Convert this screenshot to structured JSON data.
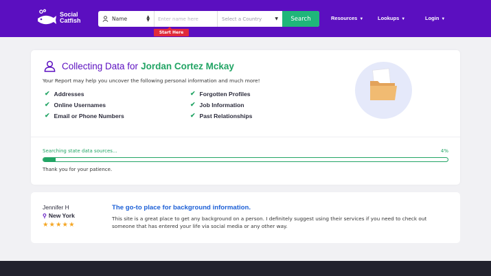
{
  "header": {
    "logo_line1": "Social",
    "logo_line2": "Catfish",
    "search_type": "Name",
    "name_placeholder": "Enter name here",
    "country_placeholder": "Select a Country",
    "search_button": "Search",
    "start_here": "Start Here",
    "nav": [
      "Resources",
      "Lookups",
      "Login"
    ]
  },
  "main": {
    "title_prefix": "Collecting Data for",
    "person_name": "Jordan Cortez Mckay",
    "subtitle": "Your Report may help you uncover the following personal information and much more!",
    "features_left": [
      "Addresses",
      "Online Usernames",
      "Email or Phone Numbers"
    ],
    "features_right": [
      "Forgotten Profiles",
      "Job Information",
      "Past Relationships"
    ],
    "status_text": "Searching state data sources...",
    "progress_label": "4%",
    "progress_percent": 4,
    "patience_text": "Thank you for your patience."
  },
  "review": {
    "reviewer": "Jennifer H",
    "location": "New York",
    "stars": "★★★★★",
    "rating": 5,
    "title": "The go-to place for background information.",
    "text": "This site is a great place to get any background on a person. I definitely suggest using their services if you need to check out someone that has entered your life via social media or any other way."
  },
  "colors": {
    "brand": "#5b0fc0",
    "accent_green": "#21a464",
    "button_green": "#1fb67a",
    "start_red": "#e02a3a",
    "link_blue": "#1c5fd6",
    "star": "#f5a623",
    "footer": "#22222e"
  }
}
